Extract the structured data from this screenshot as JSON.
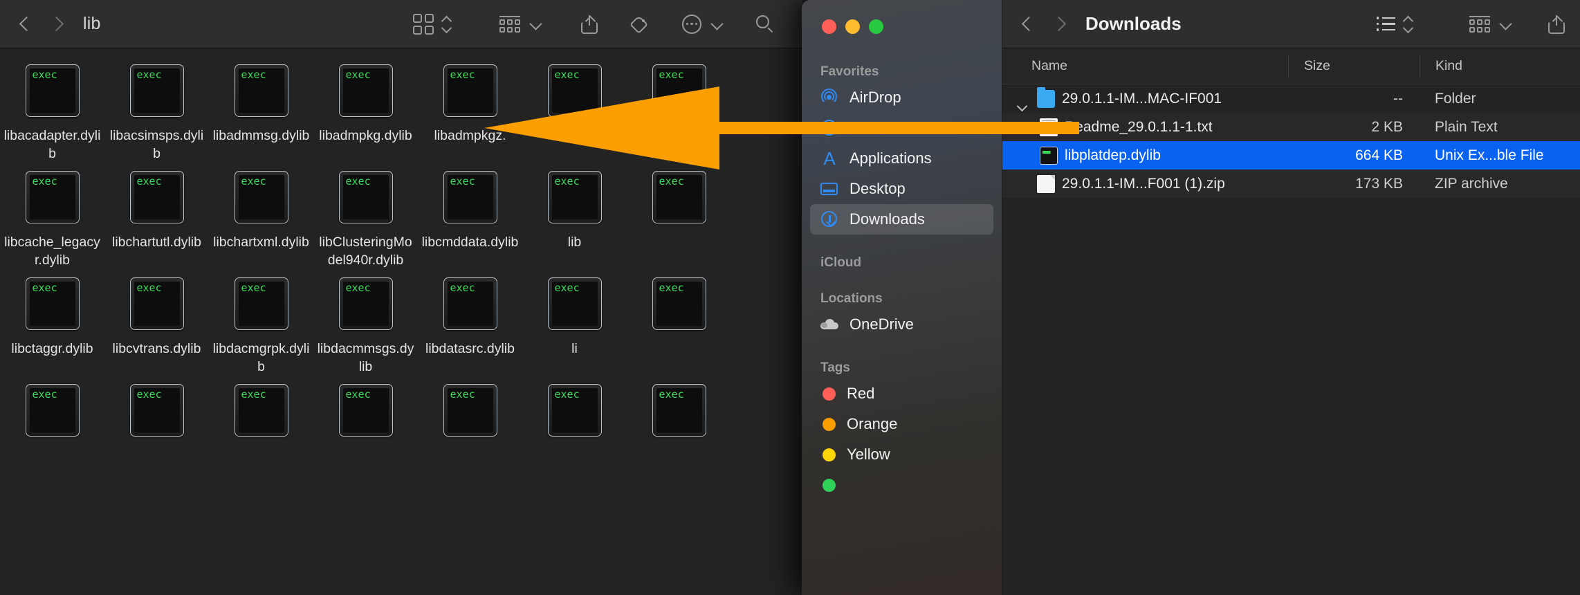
{
  "back_window": {
    "title": "lib",
    "nav": {
      "back_icon": "chevron-left-icon",
      "forward_icon": "chevron-right-icon"
    },
    "toolbar_icons": [
      "icon-view-icon",
      "view-stepper-icon",
      "group-by-icon",
      "chevron-down-icon",
      "share-icon",
      "tag-icon",
      "more-icon",
      "chevron-down-icon",
      "search-icon"
    ],
    "icon_badge_text": "exec",
    "files": [
      "libacadapter.dylib",
      "libacsimsps.dylib",
      "libadmmsg.dylib",
      "libadmpkg.dylib",
      "libadmpkgz.",
      "li",
      "",
      "libcache_legacyr.dylib",
      "libchartutl.dylib",
      "libchartxml.dylib",
      "libClusteringModel940r.dylib",
      "libcmddata.dylib",
      "lib",
      "",
      "libctaggr.dylib",
      "libcvtrans.dylib",
      "libdacmgrpk.dylib",
      "libdacmmsgs.dylib",
      "libdatasrc.dylib",
      "li",
      "",
      "",
      "",
      "",
      "",
      "",
      "",
      ""
    ]
  },
  "front_window": {
    "traffic_lights": {
      "close": "#ff5f57",
      "minimize": "#febc2e",
      "zoom": "#28c840"
    },
    "title": "Downloads",
    "nav": {
      "back_icon": "chevron-left-icon",
      "forward_icon": "chevron-right-icon"
    },
    "toolbar_icons": [
      "list-view-icon",
      "view-stepper-icon",
      "group-by-icon",
      "chevron-down-icon",
      "share-icon"
    ],
    "sidebar": {
      "sections": [
        {
          "label": "Favorites",
          "items": [
            {
              "label": "AirDrop",
              "icon": "airdrop-icon",
              "selected": false
            },
            {
              "label": "Recents",
              "icon": "clock-icon",
              "selected": false
            },
            {
              "label": "Applications",
              "icon": "applications-icon",
              "selected": false
            },
            {
              "label": "Desktop",
              "icon": "desktop-icon",
              "selected": false
            },
            {
              "label": "Downloads",
              "icon": "downloads-icon",
              "selected": true
            }
          ]
        },
        {
          "label": "iCloud",
          "items": []
        },
        {
          "label": "Locations",
          "items": [
            {
              "label": "OneDrive",
              "icon": "cloud-icon",
              "selected": false
            }
          ]
        },
        {
          "label": "Tags",
          "items": [
            {
              "label": "Red",
              "icon": "tag-dot-icon",
              "color": "#ff5f57",
              "selected": false
            },
            {
              "label": "Orange",
              "icon": "tag-dot-icon",
              "color": "#fa9e02",
              "selected": false
            },
            {
              "label": "Yellow",
              "icon": "tag-dot-icon",
              "color": "#ffd60a",
              "selected": false
            },
            {
              "label": "",
              "icon": "tag-dot-icon",
              "color": "#30d158",
              "selected": false
            }
          ]
        }
      ]
    },
    "columns": [
      "Name",
      "Size",
      "Kind"
    ],
    "rows": [
      {
        "name": "29.0.1.1-IM...MAC-IF001",
        "size": "--",
        "kind": "Folder",
        "icon": "folder-icon",
        "level": 0,
        "disclosed": true,
        "selected": false
      },
      {
        "name": "Readme_29.0.1.1-1.txt",
        "size": "2 KB",
        "kind": "Plain Text",
        "icon": "text-file-icon",
        "level": 1,
        "disclosed": false,
        "selected": false
      },
      {
        "name": "libplatdep.dylib",
        "size": "664 KB",
        "kind": "Unix Ex...ble File",
        "icon": "unix-exec-icon",
        "level": 1,
        "disclosed": false,
        "selected": true
      },
      {
        "name": "29.0.1.1-IM...F001 (1).zip",
        "size": "173 KB",
        "kind": "ZIP archive",
        "icon": "zip-file-icon",
        "level": 0,
        "disclosed": false,
        "selected": false
      }
    ]
  },
  "annotation": {
    "arrow_color": "#fa9e02",
    "arrow_name": "orange-pointer-arrow"
  }
}
